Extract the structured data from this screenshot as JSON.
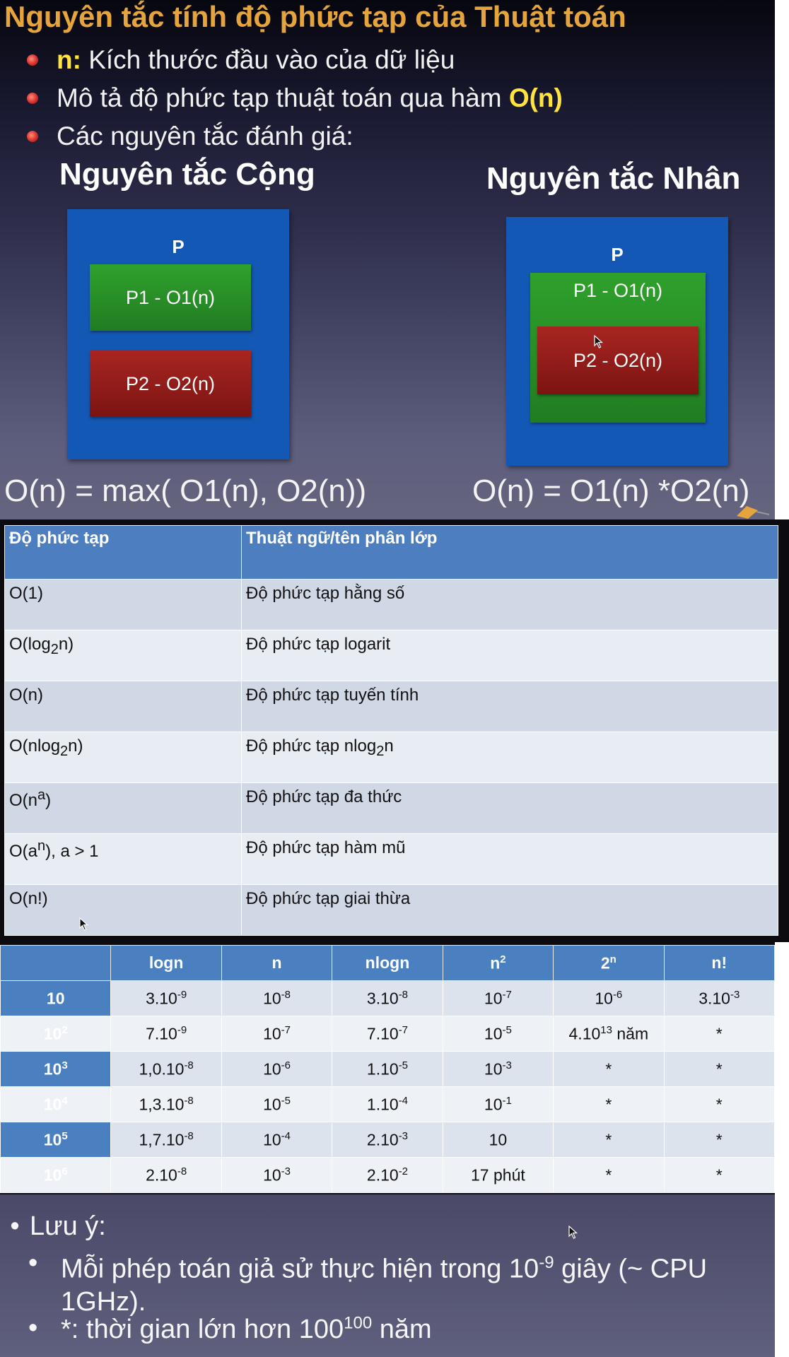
{
  "slide": {
    "title": "Nguyên tắc tính độ phức tạp của Thuật toán",
    "bullets": [
      {
        "prefix": "n:",
        "text": " Kích thước đầu vào của dữ liệu",
        "suffix": ""
      },
      {
        "prefix": "",
        "text": "Mô tả độ phức tạp thuật toán qua hàm ",
        "suffix": "O(n)"
      },
      {
        "prefix": "",
        "text": "Các nguyên tắc đánh giá:",
        "suffix": ""
      }
    ],
    "add_rule": {
      "heading": "Nguyên tắc Cộng",
      "outer_label": "P",
      "p1": "P1 - O1(n)",
      "p2": "P2 - O2(n)",
      "formula": "O(n) = max( O1(n), O2(n))"
    },
    "mul_rule": {
      "heading": "Nguyên tắc Nhân",
      "outer_label": "P",
      "p1": "P1 - O1(n)",
      "p2": "P2 - O2(n)",
      "formula": "O(n) = O1(n) *O2(n)"
    },
    "colors": {
      "title": "#e5a43c",
      "highlight": "#ffe33e",
      "box_blue": "#1458b5",
      "box_green": "#2fa12c",
      "box_red": "#a82521"
    }
  },
  "complexity_table": {
    "headers": [
      "Độ phức tạp",
      "Thuật ngữ/tên phân lớp"
    ],
    "rows": [
      {
        "c": [
          "O(1)",
          "",
          ""
        ],
        "n": [
          "Độ phức tạp hằng số",
          "",
          ""
        ]
      },
      {
        "c": [
          "O(log",
          "2",
          "n)"
        ],
        "n": [
          "Độ phức tạp logarit",
          "",
          ""
        ]
      },
      {
        "c": [
          "O(n)",
          "",
          ""
        ],
        "n": [
          "Độ phức tạp tuyến tính",
          "",
          ""
        ]
      },
      {
        "c": [
          "O(nlog",
          "2",
          "n)"
        ],
        "n": [
          "Độ phức tạp nlog",
          "2",
          "n"
        ]
      },
      {
        "c": [
          "O(n",
          "a",
          ")"
        ],
        "n": [
          "Độ phức tạp đa thức",
          "",
          ""
        ]
      },
      {
        "c": [
          "O(a",
          "n",
          "), a > 1"
        ],
        "n": [
          "Độ phức tạp hàm mũ",
          "",
          ""
        ]
      },
      {
        "c": [
          "O(n!)",
          "",
          ""
        ],
        "n": [
          "Độ phức tạp giai thừa",
          "",
          ""
        ]
      }
    ]
  },
  "timing_table": {
    "headers": [
      {
        "base": "",
        "sup": ""
      },
      {
        "base": "logn",
        "sup": ""
      },
      {
        "base": "n",
        "sup": ""
      },
      {
        "base": "nlogn",
        "sup": ""
      },
      {
        "base": "n",
        "sup": "2"
      },
      {
        "base": "2",
        "sup": "n"
      },
      {
        "base": "n!",
        "sup": ""
      }
    ],
    "rows": [
      [
        {
          "b": "10",
          "s": "",
          "t": ""
        },
        {
          "b": "3.10",
          "s": "-9",
          "t": ""
        },
        {
          "b": "10",
          "s": "-8",
          "t": ""
        },
        {
          "b": "3.10",
          "s": "-8",
          "t": ""
        },
        {
          "b": "10",
          "s": "-7",
          "t": ""
        },
        {
          "b": "10",
          "s": "-6",
          "t": ""
        },
        {
          "b": "3.10",
          "s": "-3",
          "t": ""
        }
      ],
      [
        {
          "b": "10",
          "s": "2",
          "t": ""
        },
        {
          "b": "7.10",
          "s": "-9",
          "t": ""
        },
        {
          "b": "10",
          "s": "-7",
          "t": ""
        },
        {
          "b": "7.10",
          "s": "-7",
          "t": ""
        },
        {
          "b": "10",
          "s": "-5",
          "t": ""
        },
        {
          "b": "4.10",
          "s": "13",
          "t": " năm"
        },
        {
          "b": "*",
          "s": "",
          "t": ""
        }
      ],
      [
        {
          "b": "10",
          "s": "3",
          "t": ""
        },
        {
          "b": "1,0.10",
          "s": "-8",
          "t": ""
        },
        {
          "b": "10",
          "s": "-6",
          "t": ""
        },
        {
          "b": "1.10",
          "s": "-5",
          "t": ""
        },
        {
          "b": "10",
          "s": "-3",
          "t": ""
        },
        {
          "b": "*",
          "s": "",
          "t": ""
        },
        {
          "b": "*",
          "s": "",
          "t": ""
        }
      ],
      [
        {
          "b": "10",
          "s": "4",
          "t": ""
        },
        {
          "b": "1,3.10",
          "s": "-8",
          "t": ""
        },
        {
          "b": "10",
          "s": "-5",
          "t": ""
        },
        {
          "b": "1.10",
          "s": "-4",
          "t": ""
        },
        {
          "b": "10",
          "s": "-1",
          "t": ""
        },
        {
          "b": "*",
          "s": "",
          "t": ""
        },
        {
          "b": "*",
          "s": "",
          "t": ""
        }
      ],
      [
        {
          "b": "10",
          "s": "5",
          "t": ""
        },
        {
          "b": "1,7.10",
          "s": "-8",
          "t": ""
        },
        {
          "b": "10",
          "s": "-4",
          "t": ""
        },
        {
          "b": "2.10",
          "s": "-3",
          "t": ""
        },
        {
          "b": "10",
          "s": "",
          "t": ""
        },
        {
          "b": "*",
          "s": "",
          "t": ""
        },
        {
          "b": "*",
          "s": "",
          "t": ""
        }
      ],
      [
        {
          "b": "10",
          "s": "6",
          "t": ""
        },
        {
          "b": "2.10",
          "s": "-8",
          "t": ""
        },
        {
          "b": "10",
          "s": "-3",
          "t": ""
        },
        {
          "b": "2.10",
          "s": "-2",
          "t": ""
        },
        {
          "b": "17 phút",
          "s": "",
          "t": ""
        },
        {
          "b": "*",
          "s": "",
          "t": ""
        },
        {
          "b": "*",
          "s": "",
          "t": ""
        }
      ]
    ]
  },
  "notes": {
    "bullet_main": "•",
    "bullet_sub": "•",
    "heading": "Lưu ý:",
    "note1_a": "Mỗi phép toán giả sử thực hiện trong 10",
    "note1_sup": "-9",
    "note1_b": " giây (~ CPU 1GHz).",
    "note2_a": "*: thời gian lớn hơn 100",
    "note2_sup": "100",
    "note2_b": " năm"
  }
}
